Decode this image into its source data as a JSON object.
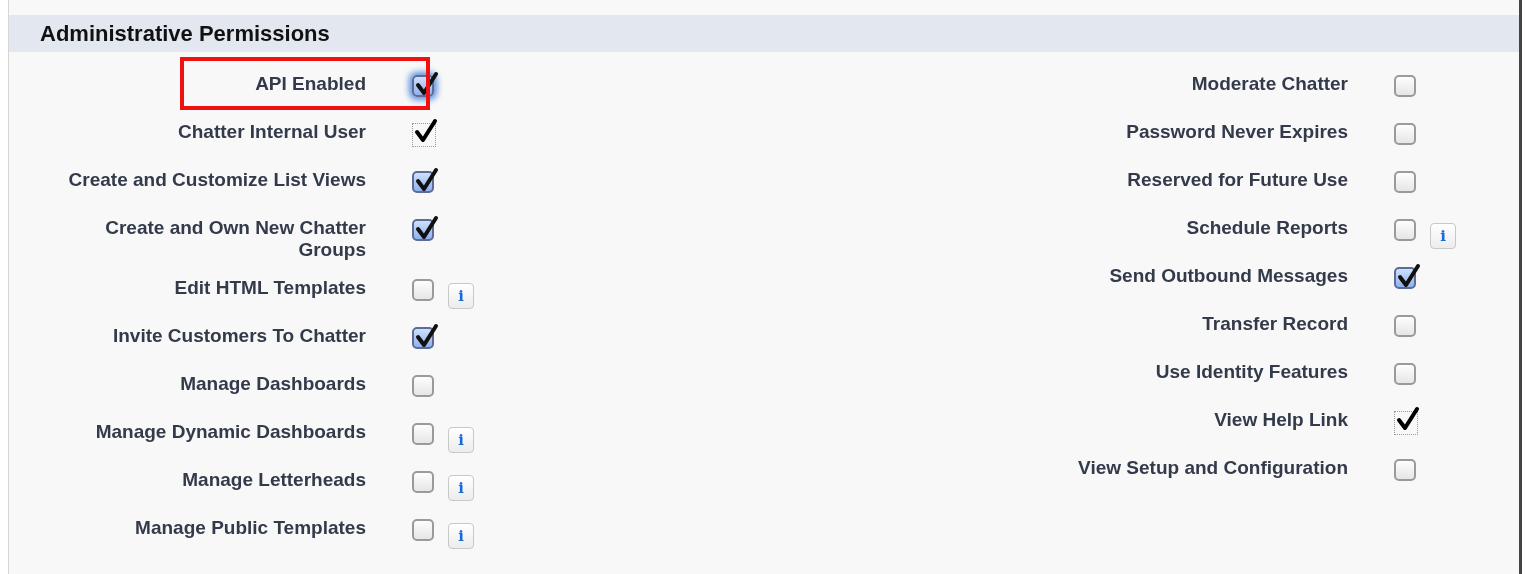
{
  "section": {
    "title": "Administrative Permissions"
  },
  "columns": [
    {
      "permissions": [
        {
          "label": "API Enabled",
          "kind": "checkbox",
          "checked": true,
          "focused": true,
          "highlighted": true
        },
        {
          "label": "Chatter Internal User",
          "kind": "readonly",
          "checked": true
        },
        {
          "label": "Create and Customize List Views",
          "kind": "checkbox",
          "checked": true
        },
        {
          "label": "Create and Own New Chatter Groups",
          "kind": "checkbox",
          "checked": true
        },
        {
          "label": "Edit HTML Templates",
          "kind": "checkbox",
          "checked": false,
          "help": "i"
        },
        {
          "label": "Invite Customers To Chatter",
          "kind": "checkbox",
          "checked": true
        },
        {
          "label": "Manage Dashboards",
          "kind": "checkbox",
          "checked": false
        },
        {
          "label": "Manage Dynamic Dashboards",
          "kind": "checkbox",
          "checked": false,
          "help": "i"
        },
        {
          "label": "Manage Letterheads",
          "kind": "checkbox",
          "checked": false,
          "help": "i"
        },
        {
          "label": "Manage Public Templates",
          "kind": "checkbox",
          "checked": false,
          "help": "i"
        }
      ]
    },
    {
      "permissions": [
        {
          "label": "Moderate Chatter",
          "kind": "checkbox",
          "checked": false
        },
        {
          "label": "Password Never Expires",
          "kind": "checkbox",
          "checked": false
        },
        {
          "label": "Reserved for Future Use",
          "kind": "checkbox",
          "checked": false
        },
        {
          "label": "Schedule Reports",
          "kind": "checkbox",
          "checked": false,
          "help": "i"
        },
        {
          "label": "Send Outbound Messages",
          "kind": "checkbox",
          "checked": true
        },
        {
          "label": "Transfer Record",
          "kind": "checkbox",
          "checked": false
        },
        {
          "label": "Use Identity Features",
          "kind": "checkbox",
          "checked": false
        },
        {
          "label": "View Help Link",
          "kind": "readonly",
          "checked": true
        },
        {
          "label": "View Setup and Configuration",
          "kind": "checkbox",
          "checked": false
        }
      ]
    }
  ]
}
